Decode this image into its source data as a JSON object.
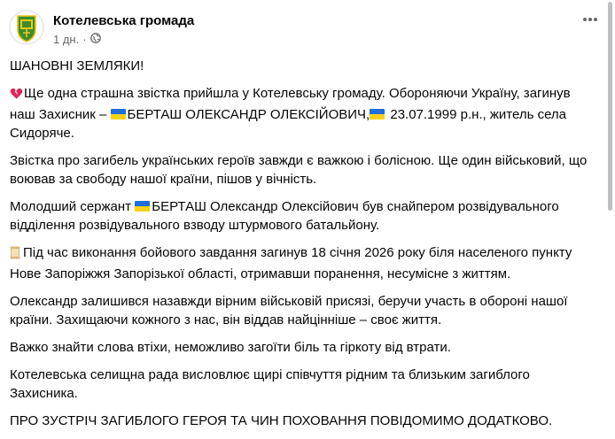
{
  "post": {
    "page_name": "Котелевська громада",
    "time": "1 дн.",
    "dot": "·",
    "paragraphs": {
      "p1": "ШАНОВНІ ЗЕМЛЯКИ!",
      "p2a": "Ще одна страшна звістка прийшла у Котелевську громаду. Обороняючи Україну, загинув наш Захисник – ",
      "p2b": "БЕРТАШ ОЛЕКСАНДР ОЛЕКСІЙОВИЧ,",
      "p2c": " 23.07.1999 р.н., житель села Сидоряче.",
      "p3": "Звістка про загибель українських героїв завжди є важкою і болісною. Ще один військовий, що воював за свободу нашої країни, пішов у вічність.",
      "p4a": "Молодший сержант ",
      "p4b": "БЕРТАШ Олександр Олексійович був снайпером розвідувального відділення розвідувального взводу штурмового батальйону.",
      "p5": "Під час виконання бойового завдання загинув 18 січня 2026 року біля населеного пункту Нове Запоріжжя Запорізької області, отримавши поранення, несумісне з життям.",
      "p6": "Олександр залишився назавжди вірним військовій присязі, беручи участь в обороні нашої країни. Захищаючи кожного з нас, він віддав найцінніше – своє життя.",
      "p7": "Важко знайти слова втіхи, неможливо загоїти біль та гіркоту від втрати.",
      "p8": "Котелевська селищна рада висловлює щирі співчуття рідним та близьким загиблого Захисника.",
      "p9": "ПРО ЗУСТРІЧ ЗАГИБЛОГО ГЕРОЯ ТА ЧИН ПОХОВАННЯ ПОВІДОМИМО ДОДАТКОВО."
    },
    "icons": {
      "privacy": "globe-icon",
      "more": "more-horizontal-icon",
      "broken_heart": "broken-heart-icon",
      "flag": "ukraine-flag-icon",
      "scroll": "scroll-icon"
    }
  },
  "colors": {
    "text": "#050505",
    "secondary_text": "#65676b",
    "flag_blue": "#1e6fd9",
    "flag_yellow": "#f7d117",
    "heart_red": "#e0245e",
    "avatar_green": "#3c8d2f"
  }
}
